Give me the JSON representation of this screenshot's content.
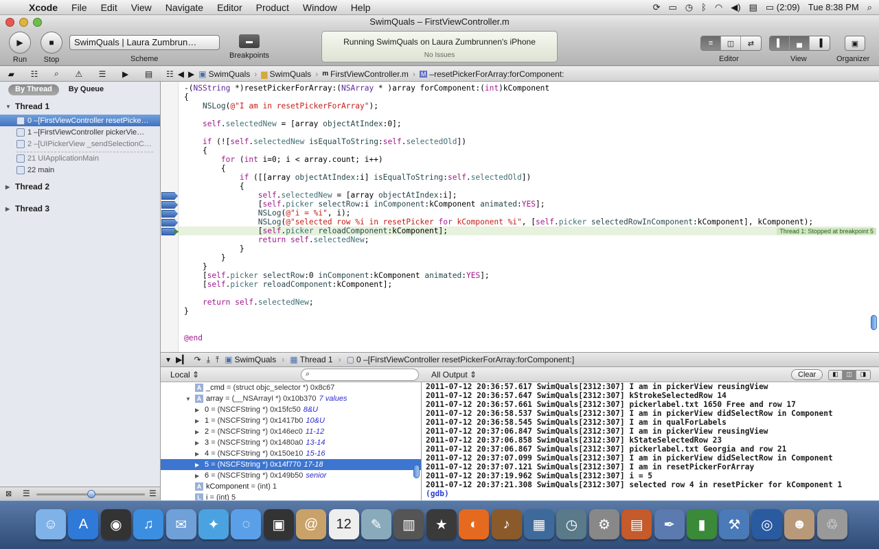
{
  "menubar": {
    "apple": "",
    "app": "Xcode",
    "items": [
      "File",
      "Edit",
      "View",
      "Navigate",
      "Editor",
      "Product",
      "Window",
      "Help"
    ],
    "battery": "(2:09)",
    "clock": "Tue 8:38 PM"
  },
  "window": {
    "title": "SwimQuals – FirstViewController.m"
  },
  "toolbar": {
    "run_label": "Run",
    "stop_label": "Stop",
    "scheme_value": "SwimQuals | Laura Zumbrun…",
    "scheme_label": "Scheme",
    "breakpoints_label": "Breakpoints",
    "status_title": "Running SwimQuals on Laura Zumbrunnen's iPhone",
    "status_sub": "No Issues",
    "editor_label": "Editor",
    "view_label": "View",
    "organizer_label": "Organizer"
  },
  "navigator": {
    "scope_by_thread": "By Thread",
    "scope_by_queue": "By Queue",
    "thread1": "Thread 1",
    "frames": [
      "0 –[FirstViewController resetPicke…",
      "1 –[FirstViewController pickerVie…",
      "2 –[UIPickerView _sendSelectionC…",
      "21 UIApplicationMain",
      "22 main"
    ],
    "thread2": "Thread 2",
    "thread3": "Thread 3"
  },
  "jumpbar": {
    "project": "SwimQuals",
    "group": "SwimQuals",
    "file": "FirstViewController.m",
    "method": "–resetPickerForArray:forComponent:"
  },
  "editor": {
    "stop_flag": "Thread 1: Stopped at breakpoint 5",
    "lines": [
      "-(NSString *)resetPickerForArray:(NSArray * )array forComponent:(int)kComponent",
      "{",
      "    NSLog(@\"I am in resetPickerForArray\");",
      "",
      "    self.selectedNew = [array objectAtIndex:0];",
      "",
      "    if (![self.selectedNew isEqualToString:self.selectedOld])",
      "    {",
      "        for (int i=0; i < array.count; i++)",
      "        {",
      "            if ([[array objectAtIndex:i] isEqualToString:self.selectedOld])",
      "            {",
      "                self.selectedNew = [array objectAtIndex:i];",
      "                [self.picker selectRow:i inComponent:kComponent animated:YES];",
      "                NSLog(@\"i = %i\", i);",
      "                NSLog(@\"selected row %i in resetPicker for kComponent %i\", [self.picker selectedRowInComponent:kComponent], kComponent);",
      "                [self.picker reloadComponent:kComponent];",
      "                return self.selectedNew;",
      "            }",
      "        }",
      "    }",
      "    [self.picker selectRow:0 inComponent:kComponent animated:YES];",
      "    [self.picker reloadComponent:kComponent];",
      "",
      "    return self.selectedNew;",
      "}",
      "",
      "",
      "@end"
    ]
  },
  "debugbar": {
    "project": "SwimQuals",
    "thread": "Thread 1",
    "frame": "0 –[FirstViewController resetPickerForArray:forComponent:]"
  },
  "variables": {
    "scope": "Local ⇕",
    "search_placeholder": "",
    "rows": [
      {
        "name": "_cmd",
        "type": "= (struct objc_selector *) 0x8c67",
        "summary": ""
      },
      {
        "name": "array",
        "type": "= (__NSArrayI *) 0x10b370",
        "summary": "7 values"
      },
      {
        "name": "0",
        "type": "= (NSCFString *) 0x15fc50",
        "summary": "8&U"
      },
      {
        "name": "1",
        "type": "= (NSCFString *) 0x1417b0",
        "summary": "10&U"
      },
      {
        "name": "2",
        "type": "= (NSCFString *) 0x146ec0",
        "summary": "11-12"
      },
      {
        "name": "3",
        "type": "= (NSCFString *) 0x1480a0",
        "summary": "13-14"
      },
      {
        "name": "4",
        "type": "= (NSCFString *) 0x150e10",
        "summary": "15-16"
      },
      {
        "name": "5",
        "type": "= (NSCFString *) 0x14f770",
        "summary": "17-18"
      },
      {
        "name": "6",
        "type": "= (NSCFString *) 0x149b50",
        "summary": "senior"
      },
      {
        "name": "kComponent",
        "type": "= (int) 1",
        "summary": ""
      },
      {
        "name": "i",
        "type": "= (int) 5",
        "summary": ""
      }
    ]
  },
  "output": {
    "filter": "All Output ⇕",
    "clear_label": "Clear",
    "lines": [
      "2011-07-12 20:36:57.617 SwimQuals[2312:307] I am in pickerView reusingView",
      "2011-07-12 20:36:57.647 SwimQuals[2312:307] kStrokeSelectedRow 14",
      "2011-07-12 20:36:57.661 SwimQuals[2312:307] pickerlabel.txt 1650 Free and row 17",
      "2011-07-12 20:36:58.537 SwimQuals[2312:307] I am in pickerView didSelectRow in Component",
      "2011-07-12 20:36:58.545 SwimQuals[2312:307] I am in qualForLabels",
      "2011-07-12 20:37:06.847 SwimQuals[2312:307] I am in pickerView reusingView",
      "2011-07-12 20:37:06.858 SwimQuals[2312:307] kStateSelectedRow 23",
      "2011-07-12 20:37:06.867 SwimQuals[2312:307] pickerlabel.txt Georgia and row 21",
      "2011-07-12 20:37:07.099 SwimQuals[2312:307] I am in pickerView didSelectRow in Component",
      "2011-07-12 20:37:07.121 SwimQuals[2312:307] I am in resetPickerForArray",
      "2011-07-12 20:37:19.962 SwimQuals[2312:307] i = 5",
      "2011-07-12 20:37:21.308 SwimQuals[2312:307] selected row 4 in resetPicker for kComponent 1",
      "(gdb)"
    ]
  },
  "dock": {
    "items": [
      "finder-icon",
      "app-store-icon",
      "dashboard-icon",
      "itunes-icon",
      "mail-icon",
      "safari-icon",
      "ichat-icon",
      "facetime-icon",
      "address-book-icon",
      "ical-icon",
      "preview-icon",
      "photo-booth-icon",
      "imovie-icon",
      "firefox-icon",
      "garageband-icon",
      "mission-control-icon",
      "time-machine-icon",
      "system-preferences-icon",
      "keynote-icon",
      "pages-icon",
      "numbers-icon",
      "xcode-icon",
      "instruments-icon",
      "user-photo-icon",
      "trash-icon"
    ],
    "labels": {
      "ical_date": "12"
    }
  }
}
